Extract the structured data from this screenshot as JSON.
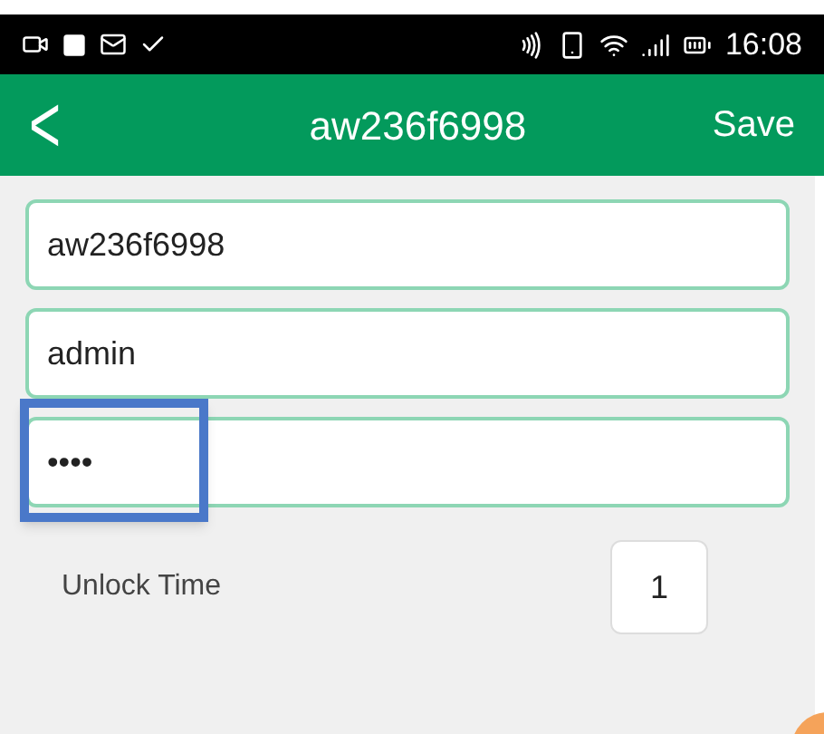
{
  "status_bar": {
    "time": "16:08"
  },
  "header": {
    "back": "<",
    "title": "aw236f6998",
    "action": "Save"
  },
  "fields": [
    {
      "value": "aw236f6998",
      "highlighted": false
    },
    {
      "value": "admin",
      "highlighted": false
    },
    {
      "value": "••••",
      "highlighted": true
    }
  ],
  "unlock_time": {
    "label": "Unlock Time",
    "value": "1"
  }
}
